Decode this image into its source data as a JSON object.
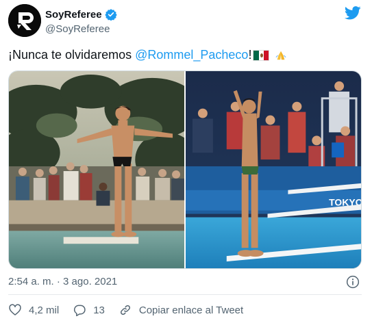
{
  "author": {
    "display_name": "SoyReferee",
    "handle": "@SoyReferee",
    "verified": true
  },
  "tweet": {
    "text_prefix": "¡Nunca te olvidaremos",
    "mention": "@Rommel_Pacheco",
    "text_suffix": "!",
    "emojis": [
      "mexico-flag",
      "folded-hands"
    ]
  },
  "media": {
    "photos": [
      {
        "subject": "child diver on platform, vintage photo"
      },
      {
        "subject": "adult diver on springboard at Tokyo pool"
      }
    ],
    "banner_text": "TOKYO"
  },
  "meta": {
    "timestamp": "2:54 a. m. · 3 ago. 2021"
  },
  "actions": {
    "likes": "4,2 mil",
    "replies": "13",
    "copy_link": "Copiar enlace al Tweet"
  },
  "colors": {
    "brand_blue": "#1d9bf0",
    "text": "#0f1419",
    "muted": "#536471",
    "border": "#cfd9de"
  }
}
